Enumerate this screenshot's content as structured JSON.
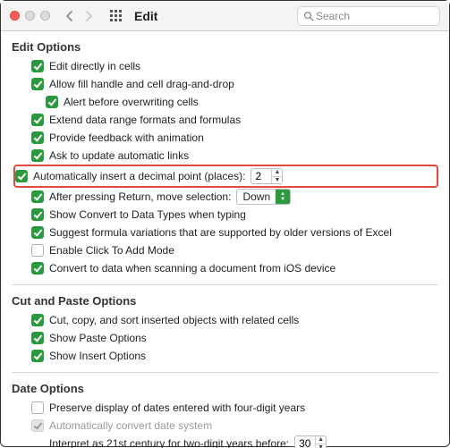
{
  "toolbar": {
    "title": "Edit",
    "search_placeholder": "Search"
  },
  "section1": {
    "heading": "Edit Options",
    "items": [
      {
        "label": "Edit directly in cells",
        "checked": true,
        "indent": 1
      },
      {
        "label": "Allow fill handle and cell drag-and-drop",
        "checked": true,
        "indent": 1
      },
      {
        "label": "Alert before overwriting cells",
        "checked": true,
        "indent": 2
      },
      {
        "label": "Extend data range formats and formulas",
        "checked": true,
        "indent": 1
      },
      {
        "label": "Provide feedback with animation",
        "checked": true,
        "indent": 1
      },
      {
        "label": "Ask to update automatic links",
        "checked": true,
        "indent": 1
      }
    ],
    "decimal": {
      "label": "Automatically insert a decimal point (places):",
      "checked": true,
      "value": "2"
    },
    "ret": {
      "label": "After pressing Return, move selection:",
      "checked": true,
      "value": "Down"
    },
    "items2": [
      {
        "label": "Show Convert to Data Types when typing",
        "checked": true,
        "indent": 1
      },
      {
        "label": "Suggest formula variations that are supported by older versions of Excel",
        "checked": true,
        "indent": 1
      },
      {
        "label": "Enable Click To Add Mode",
        "checked": false,
        "indent": 1
      },
      {
        "label": "Convert to data when scanning a document from iOS device",
        "checked": true,
        "indent": 1
      }
    ]
  },
  "section2": {
    "heading": "Cut and Paste Options",
    "items": [
      {
        "label": "Cut, copy, and sort inserted objects with related cells",
        "checked": true
      },
      {
        "label": "Show Paste Options",
        "checked": true
      },
      {
        "label": "Show Insert Options",
        "checked": true
      }
    ]
  },
  "section3": {
    "heading": "Date Options",
    "preserve": {
      "label": "Preserve display of dates entered with four-digit years",
      "checked": false
    },
    "autoconv": {
      "label": "Automatically convert date system",
      "checked": true,
      "disabled": true
    },
    "interpret": {
      "label": "Interpret as 21st century for two-digit years before:",
      "value": "30"
    }
  }
}
